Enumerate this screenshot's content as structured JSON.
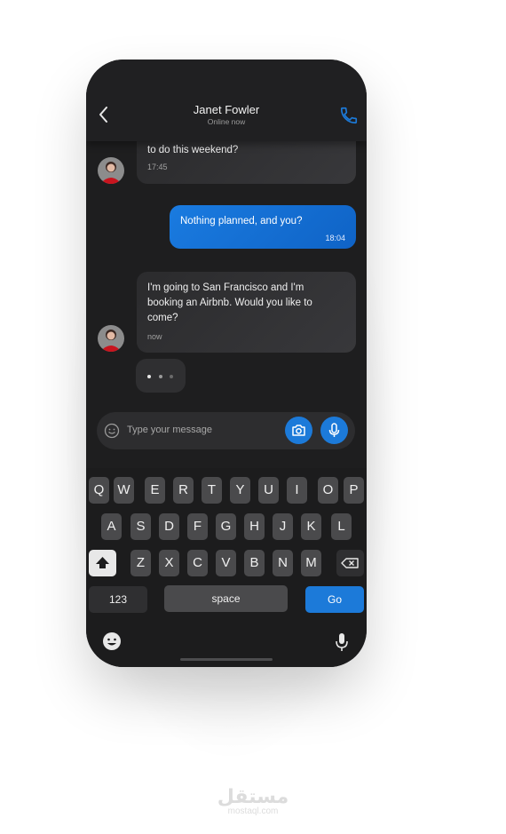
{
  "header": {
    "contact_name": "Janet Fowler",
    "status": "Online now"
  },
  "messages": [
    {
      "from": "contact",
      "text": "to do this weekend?",
      "time": "17:45"
    },
    {
      "from": "me",
      "text": "Nothing planned, and you?",
      "time": "18:04"
    },
    {
      "from": "contact",
      "lines": [
        "I'm going to San Francisco and I'm",
        "booking an Airbnb. Would you like to",
        "come?"
      ],
      "time": "now"
    }
  ],
  "composer": {
    "placeholder": "Type your message"
  },
  "keyboard": {
    "row1": [
      "Q",
      "W",
      "E",
      "R",
      "T",
      "Y",
      "U",
      "I",
      "O",
      "P"
    ],
    "row2": [
      "A",
      "S",
      "D",
      "F",
      "G",
      "H",
      "J",
      "K",
      "L"
    ],
    "row3": [
      "Z",
      "X",
      "C",
      "V",
      "B",
      "N",
      "M"
    ],
    "numbers_label": "123",
    "space_label": "space",
    "go_label": "Go"
  },
  "watermark": {
    "arabic": "مستقل",
    "latin": "mostaql.com"
  },
  "colors": {
    "accent": "#1c7ad9",
    "background": "#1e1e1f",
    "bubble_in": "#2f2f31"
  },
  "icons": [
    "back-arrow-icon",
    "phone-icon",
    "smiley-icon",
    "camera-icon",
    "microphone-icon",
    "shift-icon",
    "backspace-icon",
    "emoji-keyboard-icon",
    "dictation-icon"
  ]
}
